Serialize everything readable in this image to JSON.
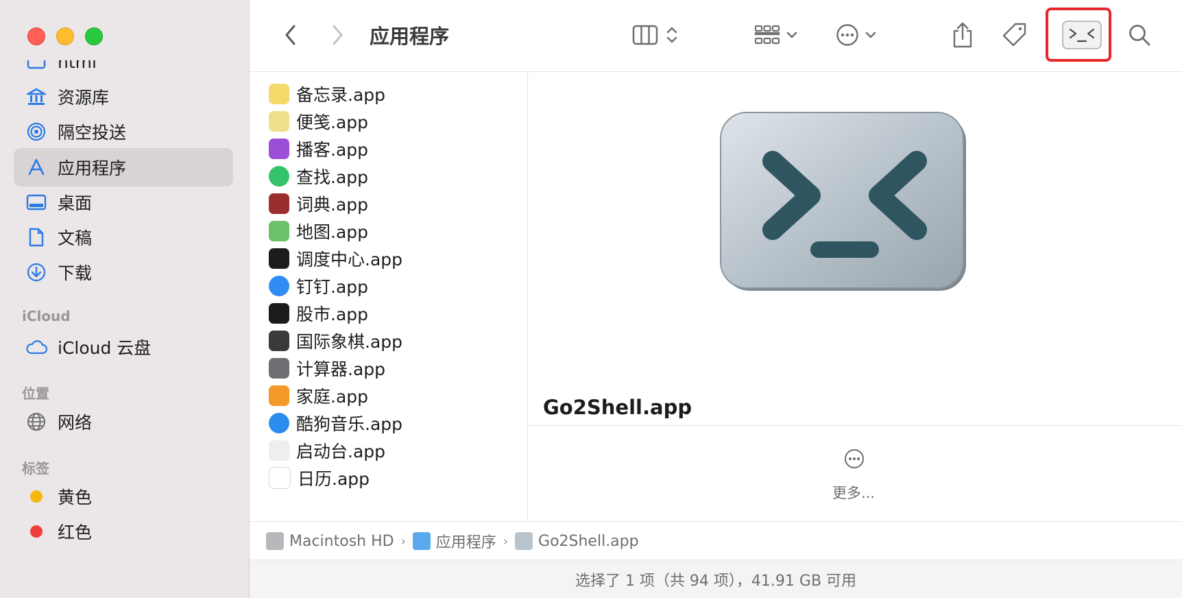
{
  "sidebar": {
    "partial_item": "html",
    "items": [
      {
        "label": "资源库"
      },
      {
        "label": "隔空投送"
      },
      {
        "label": "应用程序"
      },
      {
        "label": "桌面"
      },
      {
        "label": "文稿"
      },
      {
        "label": "下载"
      }
    ],
    "icloud_header": "iCloud",
    "icloud_drive": "iCloud 云盘",
    "locations_header": "位置",
    "network": "网络",
    "tags_header": "标签",
    "tags": [
      {
        "label": "黄色",
        "color": "#f5b80f"
      },
      {
        "label": "红色",
        "color": "#f0403b"
      }
    ]
  },
  "toolbar": {
    "title": "应用程序"
  },
  "files": [
    {
      "name": "备忘录.app",
      "icon": "notes-icon",
      "color": "#f6d96b"
    },
    {
      "name": "便笺.app",
      "icon": "stickies-icon",
      "color": "#efe08a"
    },
    {
      "name": "播客.app",
      "icon": "podcasts-icon",
      "color": "#9b4fd6"
    },
    {
      "name": "查找.app",
      "icon": "find-my-icon",
      "color": "#34c26b"
    },
    {
      "name": "词典.app",
      "icon": "dictionary-icon",
      "color": "#9a2d2d"
    },
    {
      "name": "地图.app",
      "icon": "maps-icon",
      "color": "#6cc26a"
    },
    {
      "name": "调度中心.app",
      "icon": "mission-control-icon",
      "color": "#1c1c1e"
    },
    {
      "name": "钉钉.app",
      "icon": "dingtalk-icon",
      "color": "#2f8cf4"
    },
    {
      "name": "股市.app",
      "icon": "stocks-icon",
      "color": "#1c1c1e"
    },
    {
      "name": "国际象棋.app",
      "icon": "chess-icon",
      "color": "#3a3a3a"
    },
    {
      "name": "计算器.app",
      "icon": "calculator-icon",
      "color": "#6e6e73"
    },
    {
      "name": "家庭.app",
      "icon": "home-icon",
      "color": "#f39a2b"
    },
    {
      "name": "酷狗音乐.app",
      "icon": "kugou-icon",
      "color": "#2b8cf0"
    },
    {
      "name": "启动台.app",
      "icon": "launchpad-icon",
      "color": "#eeeeee"
    },
    {
      "name": "日历.app",
      "icon": "calendar-icon",
      "color": "#ffffff"
    }
  ],
  "preview": {
    "name": "Go2Shell.app",
    "more_label": "更多..."
  },
  "pathbar": [
    {
      "label": "Macintosh HD"
    },
    {
      "label": "应用程序"
    },
    {
      "label": "Go2Shell.app"
    }
  ],
  "status": "选择了 1 项（共 94 项），41.91 GB 可用"
}
